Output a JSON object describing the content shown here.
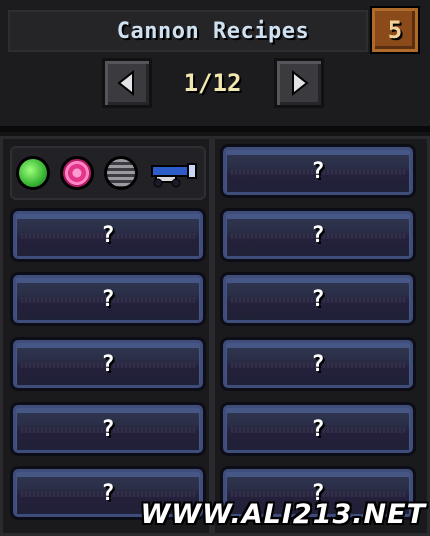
{
  "window": {
    "title": "Cannon Recipes",
    "page_indicator": "1/12",
    "prev_icon": "arrow-left-icon",
    "next_icon": "arrow-right-icon",
    "close_icon": "exit-icon",
    "close_label": "5"
  },
  "filters": [
    {
      "name": "green-orb-filter",
      "icon": "green-circle-icon",
      "color": "#4cd24a"
    },
    {
      "name": "pink-orb-filter",
      "icon": "pink-target-icon",
      "color": "#f0479a"
    },
    {
      "name": "grey-orb-filter",
      "icon": "striped-circle-icon",
      "color": "#7a7a80"
    },
    {
      "name": "cannon-filter",
      "icon": "cannon-icon",
      "color": "#2c5cc8"
    }
  ],
  "slots": {
    "unknown_label": "?",
    "left_count": 5,
    "right_count": 6
  },
  "watermark": "WWW.ALI213.NET"
}
